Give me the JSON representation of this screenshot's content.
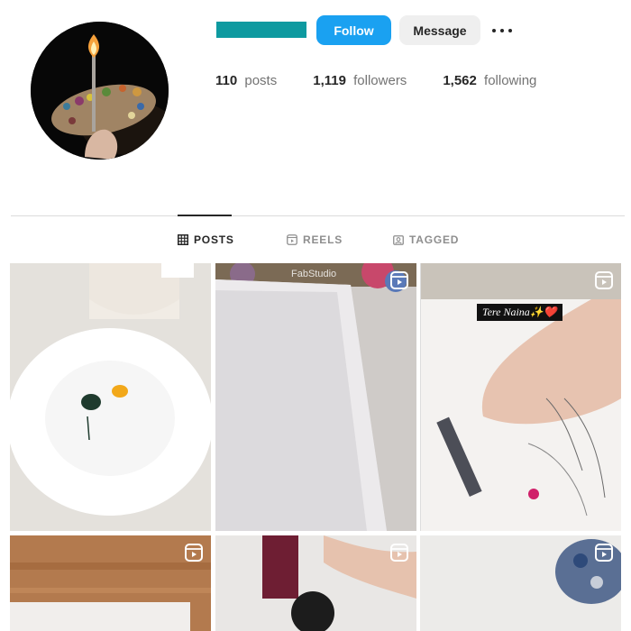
{
  "header": {
    "follow_label": "Follow",
    "message_label": "Message",
    "more_icon": "more-horizontal-icon"
  },
  "stats": {
    "posts_count": "110",
    "posts_label": "posts",
    "followers_count": "1,119",
    "followers_label": "followers",
    "following_count": "1,562",
    "following_label": "following"
  },
  "tabs": [
    {
      "label": "POSTS",
      "icon": "grid-icon",
      "active": true
    },
    {
      "label": "REELS",
      "icon": "reels-icon",
      "active": false
    },
    {
      "label": "TAGGED",
      "icon": "tagged-icon",
      "active": false
    }
  ],
  "grid": {
    "posts": [
      {
        "type": "image",
        "overlay_text": ""
      },
      {
        "type": "reel",
        "overlay_text": "FabStudio"
      },
      {
        "type": "reel",
        "overlay_text": "Tere Naina✨❤️"
      },
      {
        "type": "reel",
        "overlay_text": ""
      },
      {
        "type": "reel",
        "overlay_text": ""
      },
      {
        "type": "reel",
        "overlay_text": ""
      }
    ]
  },
  "colors": {
    "follow_button": "#1aa1f1",
    "message_button": "#efefef",
    "redacted_username": "#0e9aa0"
  }
}
